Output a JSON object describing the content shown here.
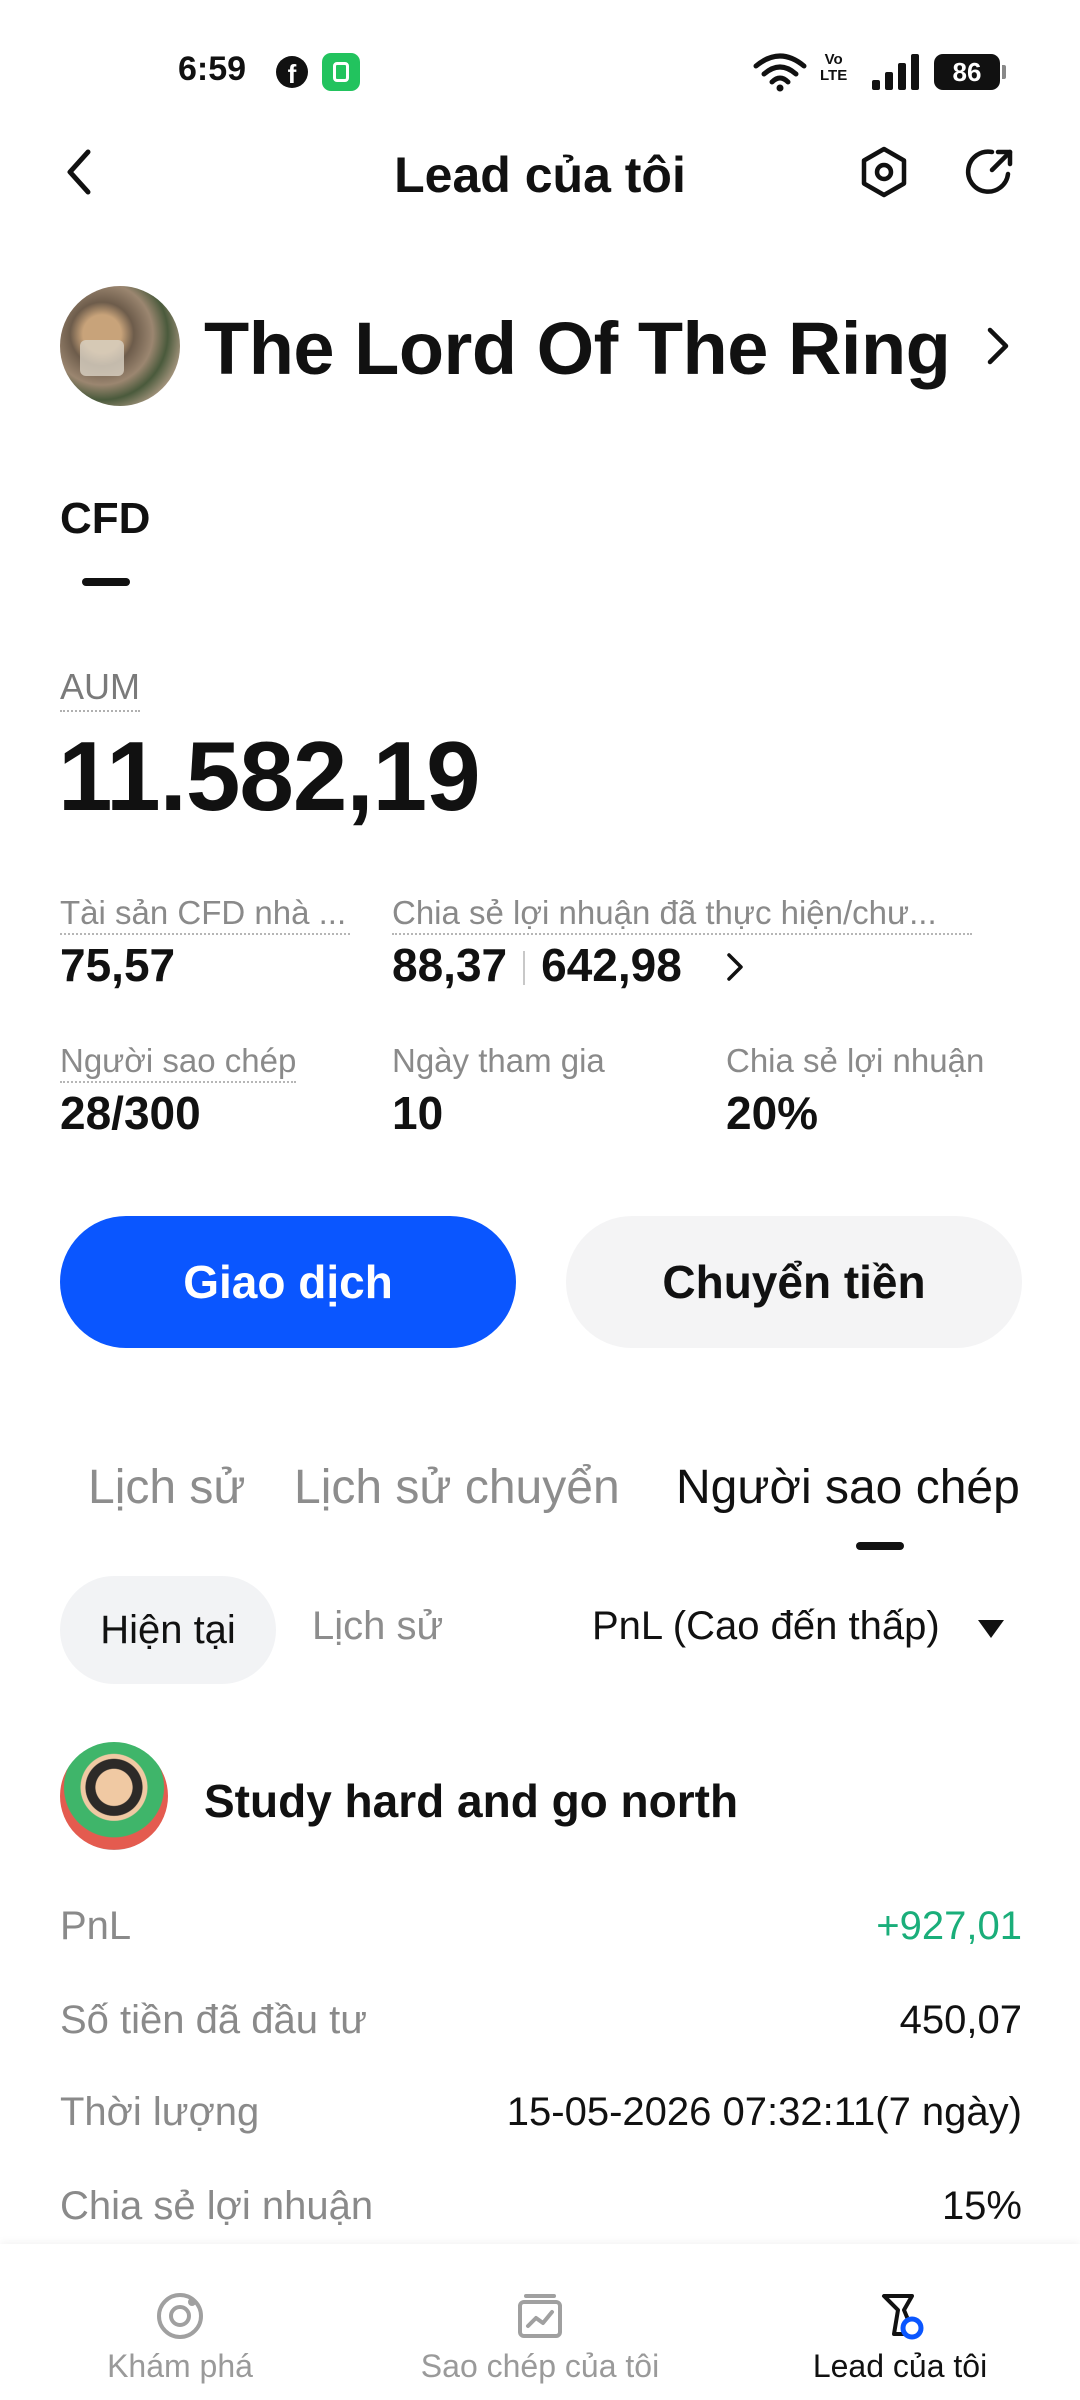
{
  "status_bar": {
    "time": "6:59",
    "volte_top": "Vo",
    "volte_bottom": "LTE",
    "battery": "86"
  },
  "header": {
    "title": "Lead của tôi"
  },
  "profile": {
    "name": "The Lord Of The Ring"
  },
  "category_tab": "CFD",
  "aum": {
    "label": "AUM",
    "value": "11.582,19"
  },
  "stats": {
    "cfd_assets": {
      "label": "Tài sản CFD nhà ...",
      "value": "75,57"
    },
    "profit_share": {
      "label": "Chia sẻ lợi nhuận đã thực hiện/chư...",
      "realized": "88,37",
      "unrealized": "642,98"
    },
    "copiers": {
      "label": "Người sao chép",
      "value": "28/300"
    },
    "join_days": {
      "label": "Ngày tham gia",
      "value": "10"
    },
    "profit_share_rate": {
      "label": "Chia sẻ lợi nhuận",
      "value": "20%"
    }
  },
  "buttons": {
    "trade": "Giao dịch",
    "transfer": "Chuyển tiền"
  },
  "main_tabs": [
    "Lịch sử",
    "Lịch sử chuyển",
    "Người sao chép"
  ],
  "filters": {
    "current": "Hiện tại",
    "history": "Lịch sử",
    "sort": "PnL (Cao đến thấp)"
  },
  "follower": {
    "name": "Study hard and go north",
    "rows": [
      {
        "label": "PnL",
        "value": "+927,01"
      },
      {
        "label": "Số tiền đã đầu tư",
        "value": "450,07"
      },
      {
        "label": "Thời lượng",
        "value": "15-05-2026 07:32:11(7 ngày)"
      },
      {
        "label": "Chia sẻ lợi nhuận",
        "value": "15%"
      }
    ]
  },
  "bottom_nav": [
    {
      "label": "Khám phá",
      "icon": "explore-icon"
    },
    {
      "label": "Sao chép của tôi",
      "icon": "copy-chart-icon"
    },
    {
      "label": "Lead của tôi",
      "icon": "lead-icon"
    }
  ],
  "colors": {
    "primary": "#0a56ff",
    "positive": "#1aae7a",
    "muted": "#8a8a8a"
  }
}
